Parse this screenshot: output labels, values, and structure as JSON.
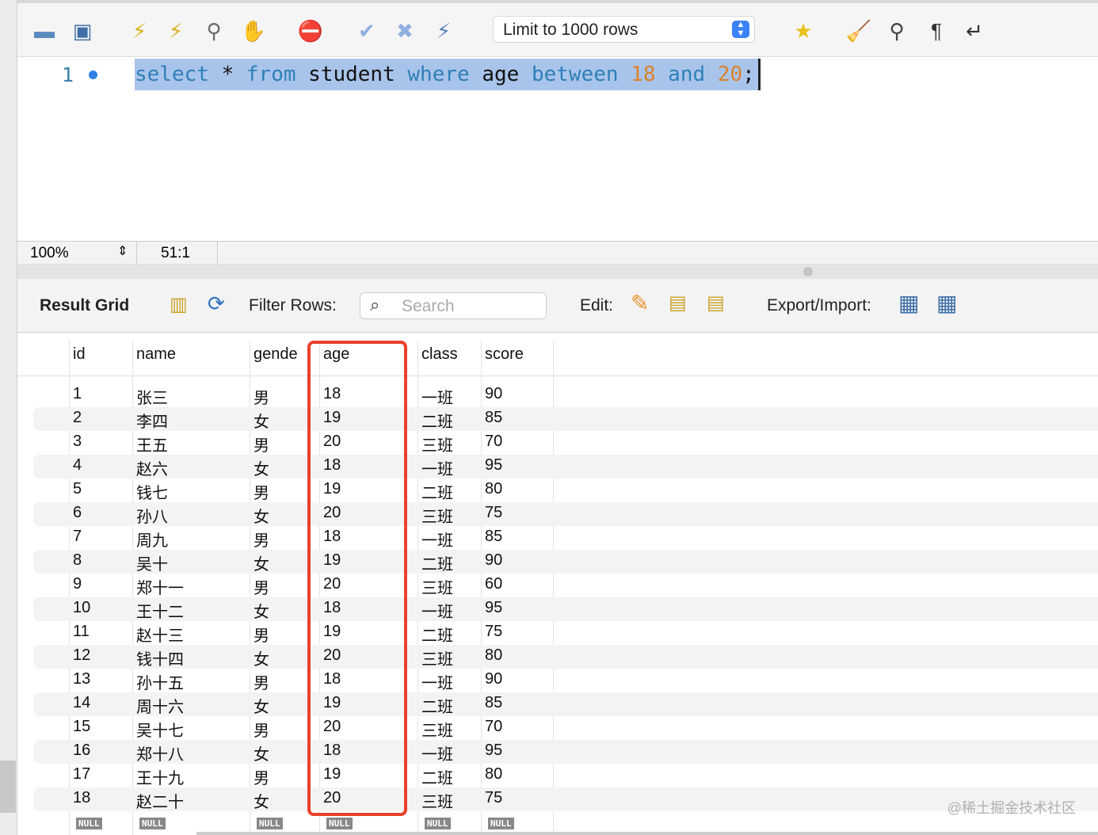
{
  "toolbar": {
    "icons": [
      "open-folder-icon",
      "save-icon",
      "execute-icon",
      "execute-current-icon",
      "explain-icon",
      "stop-icon",
      "stop-on-error-icon",
      "commit-icon",
      "rollback-icon",
      "autocommit-icon",
      "bookmark-star-icon",
      "beautify-broom-icon",
      "find-icon",
      "invisible-chars-icon",
      "wrap-lines-icon"
    ],
    "limit_select": "Limit to 1000 rows"
  },
  "editor": {
    "line_number": "1",
    "tokens": [
      {
        "t": "select",
        "c": "kw"
      },
      {
        "t": " * ",
        "c": "pl"
      },
      {
        "t": "from",
        "c": "kw"
      },
      {
        "t": " student ",
        "c": "pl"
      },
      {
        "t": "where",
        "c": "kw"
      },
      {
        "t": " age ",
        "c": "pl"
      },
      {
        "t": "between",
        "c": "kw"
      },
      {
        "t": " ",
        "c": "pl"
      },
      {
        "t": "18",
        "c": "num"
      },
      {
        "t": " ",
        "c": "pl"
      },
      {
        "t": "and",
        "c": "kw"
      },
      {
        "t": " ",
        "c": "pl"
      },
      {
        "t": "20",
        "c": "num"
      },
      {
        "t": ";",
        "c": "pl"
      }
    ]
  },
  "status": {
    "zoom": "100%",
    "cursor": "51:1"
  },
  "result_bar": {
    "title": "Result Grid",
    "filter_label": "Filter Rows:",
    "search_placeholder": "Search",
    "edit_label": "Edit:",
    "export_label": "Export/Import:"
  },
  "columns": [
    "id",
    "name",
    "gende",
    "age",
    "class",
    "score"
  ],
  "rows": [
    [
      "1",
      "张三",
      "男",
      "18",
      "一班",
      "90"
    ],
    [
      "2",
      "李四",
      "女",
      "19",
      "二班",
      "85"
    ],
    [
      "3",
      "王五",
      "男",
      "20",
      "三班",
      "70"
    ],
    [
      "4",
      "赵六",
      "女",
      "18",
      "一班",
      "95"
    ],
    [
      "5",
      "钱七",
      "男",
      "19",
      "二班",
      "80"
    ],
    [
      "6",
      "孙八",
      "女",
      "20",
      "三班",
      "75"
    ],
    [
      "7",
      "周九",
      "男",
      "18",
      "一班",
      "85"
    ],
    [
      "8",
      "吴十",
      "女",
      "19",
      "二班",
      "90"
    ],
    [
      "9",
      "郑十一",
      "男",
      "20",
      "三班",
      "60"
    ],
    [
      "10",
      "王十二",
      "女",
      "18",
      "一班",
      "95"
    ],
    [
      "11",
      "赵十三",
      "男",
      "19",
      "二班",
      "75"
    ],
    [
      "12",
      "钱十四",
      "女",
      "20",
      "三班",
      "80"
    ],
    [
      "13",
      "孙十五",
      "男",
      "18",
      "一班",
      "90"
    ],
    [
      "14",
      "周十六",
      "女",
      "19",
      "二班",
      "85"
    ],
    [
      "15",
      "吴十七",
      "男",
      "20",
      "三班",
      "70"
    ],
    [
      "16",
      "郑十八",
      "女",
      "18",
      "一班",
      "95"
    ],
    [
      "17",
      "王十九",
      "男",
      "19",
      "二班",
      "80"
    ],
    [
      "18",
      "赵二十",
      "女",
      "20",
      "三班",
      "75"
    ]
  ],
  "null_label": "NULL",
  "watermark": "@稀土掘金技术社区",
  "colors": {
    "highlight": "#e8412c",
    "keyword": "#2f7fb8",
    "number": "#d9822b",
    "selection": "#a9c4ea"
  }
}
